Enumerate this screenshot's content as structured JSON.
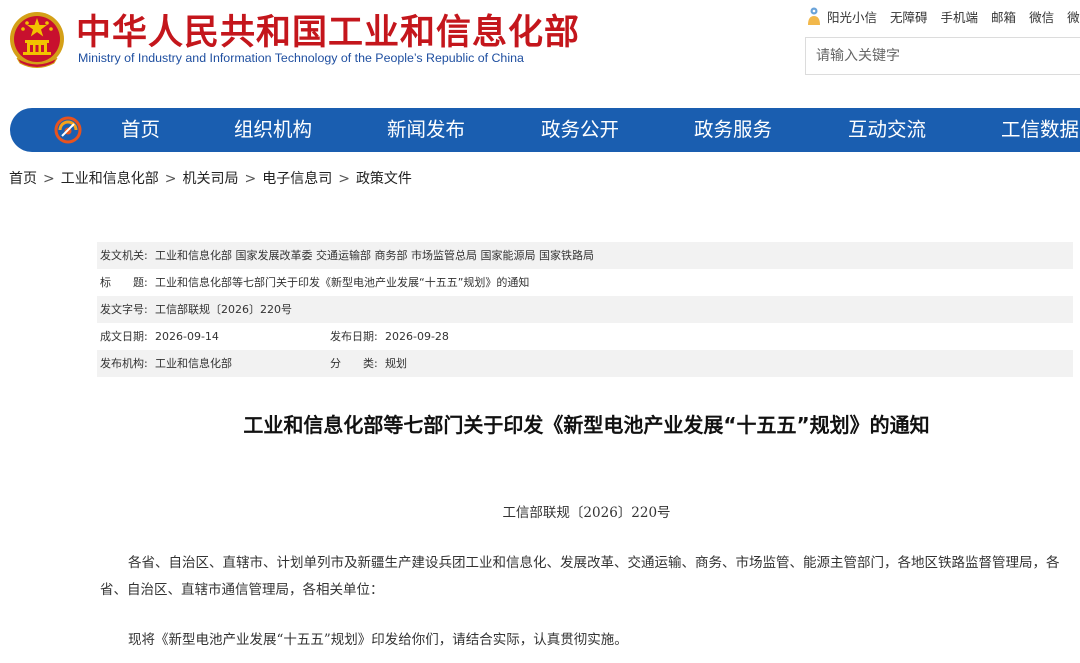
{
  "header": {
    "site_title": "中华人民共和国工业和信息化部",
    "site_subtitle": "Ministry of Industry and Information Technology of the People’s Republic of China",
    "top_links": [
      "阳光小信",
      "无障碍",
      "手机端",
      "邮箱",
      "微信",
      "微"
    ],
    "search_placeholder": "请输入关键字"
  },
  "nav": {
    "items": [
      "首页",
      "组织机构",
      "新闻发布",
      "政务公开",
      "政务服务",
      "互动交流",
      "工信数据"
    ]
  },
  "breadcrumb": [
    "首页",
    "工业和信息化部",
    "机关司局",
    "电子信息司",
    "政策文件"
  ],
  "meta": {
    "issuer_label": "发文机关:",
    "issuer_value": "工业和信息化部 国家发展改革委 交通运输部 商务部 市场监管总局 国家能源局 国家铁路局",
    "title_label": "标　　题:",
    "title_value": "工业和信息化部等七部门关于印发《新型电池产业发展“十五五”规划》的通知",
    "docno_label": "发文字号:",
    "docno_value": "工信部联规〔2026〕220号",
    "written_label": "成文日期:",
    "written_value": "2026-09-14",
    "published_label": "发布日期:",
    "published_value": "2026-09-28",
    "org_label": "发布机构:",
    "org_value": "工业和信息化部",
    "category_label": "分　　类:",
    "category_value": "规划"
  },
  "article": {
    "title": "工业和信息化部等七部门关于印发《新型电池产业发展“十五五”规划》的通知",
    "doc_number": "工信部联规〔2026〕220号",
    "para1": "各省、自治区、直辖市、计划单列市及新疆生产建设兵团工业和信息化、发展改革、交通运输、商务、市场监管、能源主管部门，各地区铁路监督管理局，各省、自治区、直辖市通信管理局，各相关单位：",
    "para2": "现将《新型电池产业发展“十五五”规划》印发给你们，请结合实际，认真贯彻实施。"
  },
  "colors": {
    "title_red": "#c4161c",
    "subtitle_blue": "#1f4fa0",
    "nav_blue": "#1a5eb0",
    "meta_shade": "#f2f2f2"
  },
  "icons": {
    "emblem": "national-emblem-icon",
    "person": "person-icon",
    "nav_logo": "miit-logo-icon"
  }
}
